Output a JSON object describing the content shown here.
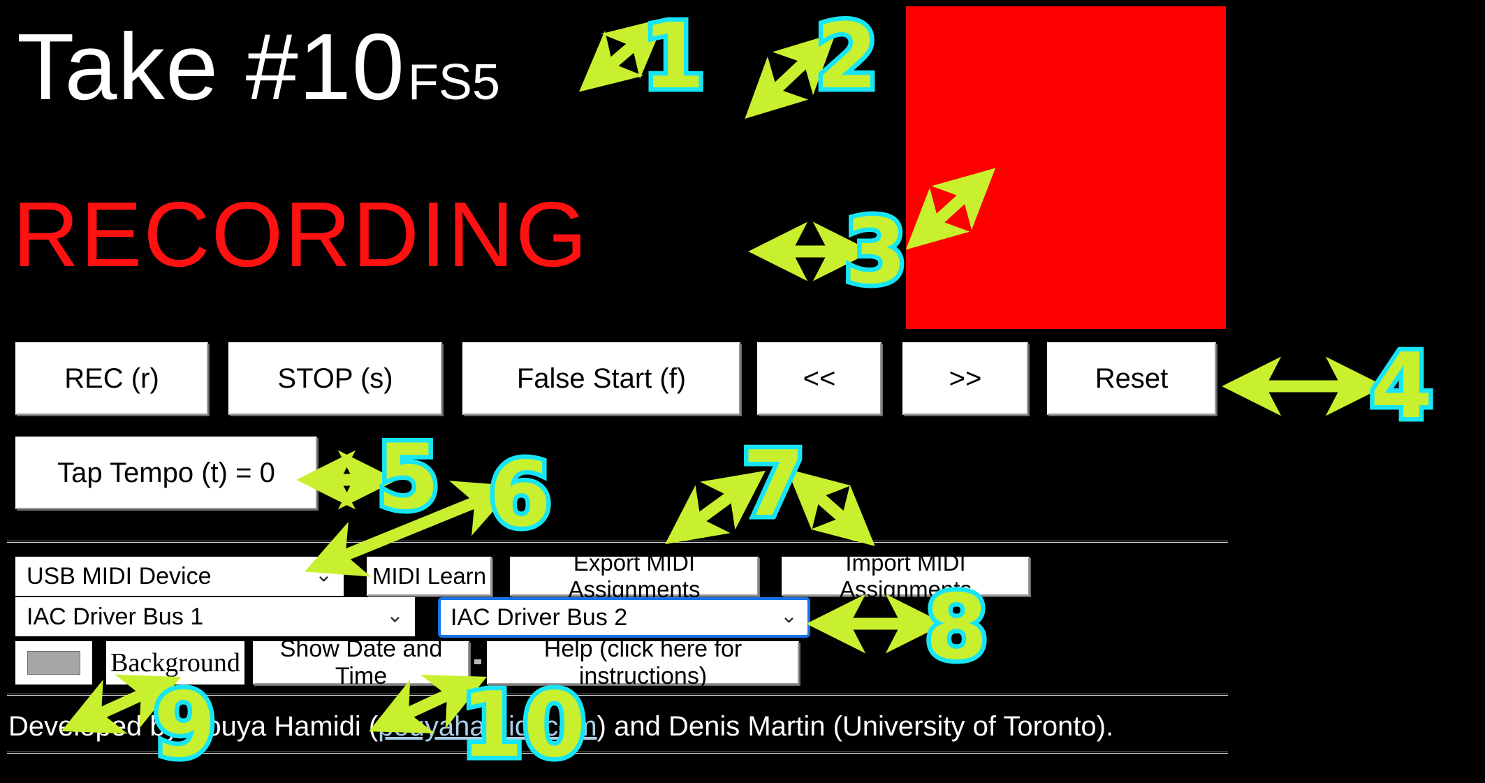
{
  "app": {
    "background_color": "#000000",
    "take_title": "Take #10",
    "take_note": "FS5",
    "status_text": "RECORDING",
    "status_color": "#ff1111",
    "status_box_color": "#ff0000"
  },
  "transport": {
    "rec_label": "REC (r)",
    "stop_label": "STOP (s)",
    "false_start_label": "False Start (f)",
    "prev_label": "<<",
    "next_label": ">>",
    "reset_label": "Reset"
  },
  "tempo": {
    "tap_label": "Tap Tempo (t) = 0"
  },
  "midi": {
    "device_select_value": "USB MIDI Device",
    "learn_label": "MIDI Learn",
    "export_label": "Export MIDI Assignments",
    "import_label": "Import MIDI Assignments",
    "bus1_select_value": "IAC Driver Bus 1",
    "bus2_select_value": "IAC Driver Bus 2",
    "chevron": "⌄"
  },
  "options": {
    "color_swatch_value": "#a6a6a6",
    "background_label": "Background",
    "datetime_label": "Show Date and Time",
    "help_label": "Help (click here for instructions)"
  },
  "footer": {
    "credit_prefix": "Developed by Pouya Hamidi (",
    "credit_link": "pouyahamidi.com",
    "credit_suffix": ") and Denis Martin (University of Toronto)."
  },
  "annotations": {
    "accent_fill": "#c8f02e",
    "accent_outline": "#17e5f5",
    "markers": [
      {
        "id": "1",
        "label": "1"
      },
      {
        "id": "2",
        "label": "2"
      },
      {
        "id": "3",
        "label": "3"
      },
      {
        "id": "4",
        "label": "4"
      },
      {
        "id": "5",
        "label": "5"
      },
      {
        "id": "6",
        "label": "6"
      },
      {
        "id": "7",
        "label": "7"
      },
      {
        "id": "8",
        "label": "8"
      },
      {
        "id": "9",
        "label": "9"
      },
      {
        "id": "10",
        "label": "10"
      }
    ]
  }
}
